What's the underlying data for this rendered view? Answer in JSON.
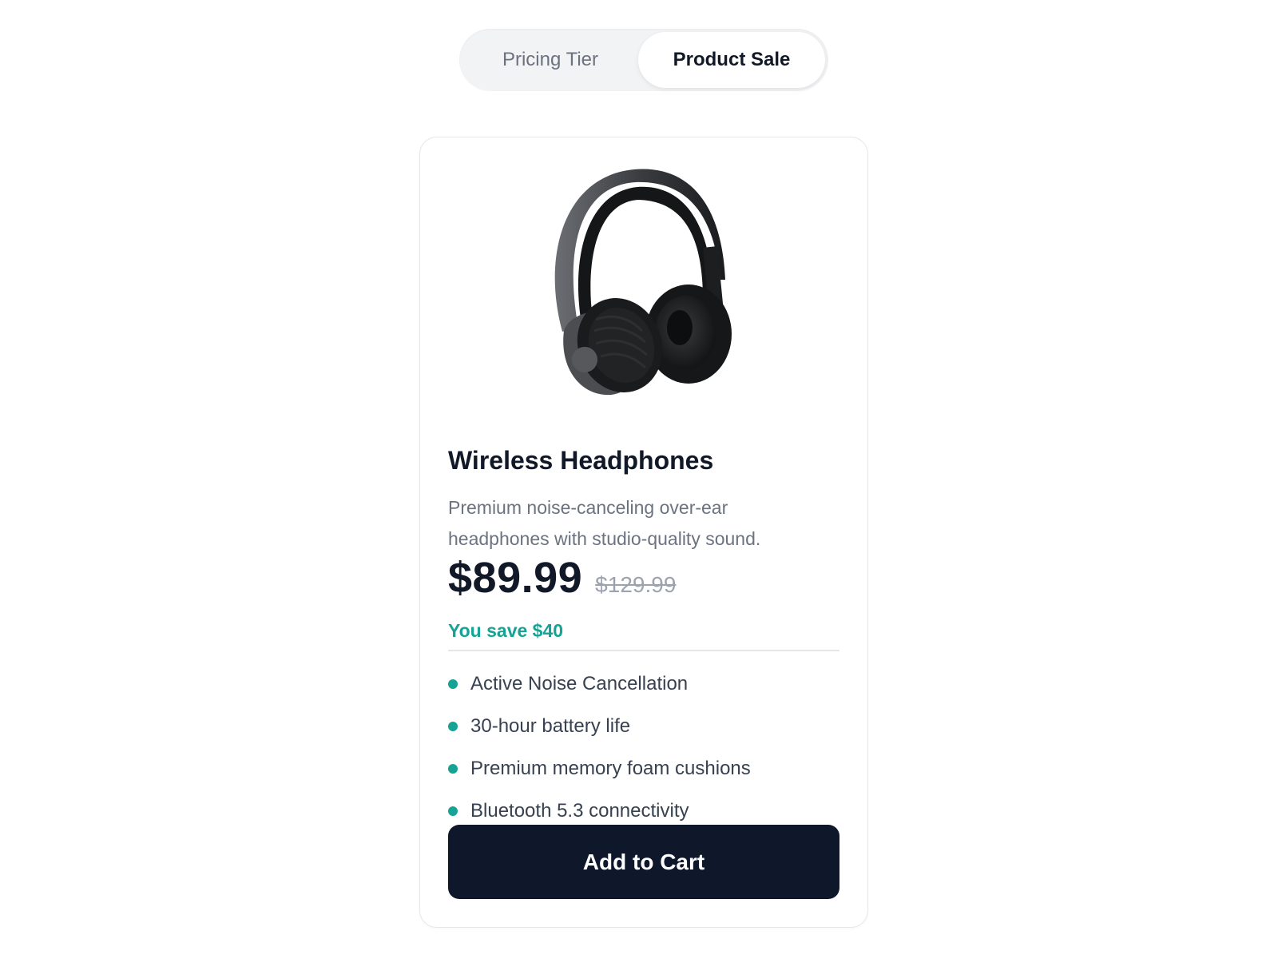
{
  "toggle": {
    "tabs": [
      {
        "label": "Pricing Tier",
        "active": false
      },
      {
        "label": "Product Sale",
        "active": true
      }
    ]
  },
  "product": {
    "image_icon": "headphones-image",
    "title": "Wireless Headphones",
    "description": "Premium noise-canceling over-ear headphones with studio-quality sound.",
    "price": "$89.99",
    "original_price": "$129.99",
    "savings": "You save $40",
    "features": [
      "Active Noise Cancellation",
      "30-hour battery life",
      "Premium memory foam cushions",
      "Bluetooth 5.3 connectivity"
    ],
    "cta_label": "Add to Cart"
  },
  "colors": {
    "accent": "#14a394",
    "button_bg": "#0f172a",
    "title": "#111827",
    "muted": "#6b7280"
  }
}
